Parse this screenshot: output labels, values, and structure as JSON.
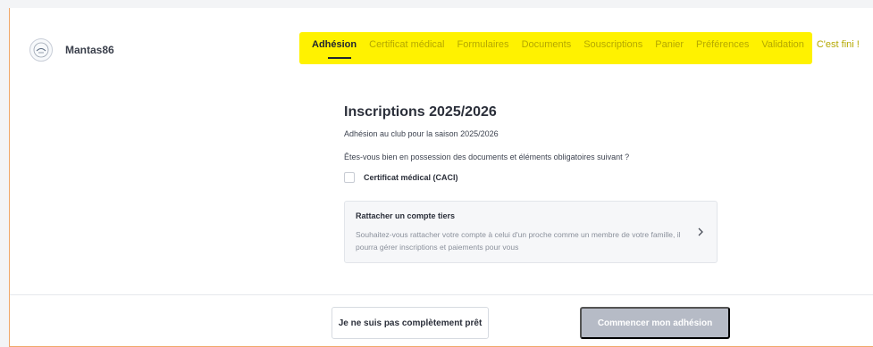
{
  "header": {
    "club_name": "Mantas86",
    "logo_icon": "club-logo-icon",
    "highlight_color": "#fff200",
    "nav": [
      {
        "label": "Adhésion",
        "active": true
      },
      {
        "label": "Certificat médical",
        "active": false
      },
      {
        "label": "Formulaires",
        "active": false
      },
      {
        "label": "Documents",
        "active": false
      },
      {
        "label": "Souscriptions",
        "active": false
      },
      {
        "label": "Panier",
        "active": false
      },
      {
        "label": "Préférences",
        "active": false
      },
      {
        "label": "Validation",
        "active": false
      },
      {
        "label": "C'est fini !",
        "active": false
      }
    ]
  },
  "main": {
    "title": "Inscriptions 2025/2026",
    "subtitle": "Adhésion au club pour la saison 2025/2026",
    "question": "Êtes-vous bien en possession des documents et éléments obligatoires suivant ?",
    "checkbox_label": "Certificat médical (CACI)",
    "card": {
      "title": "Rattacher un compte tiers",
      "text": "Souhaitez-vous rattacher votre compte à celui d'un proche comme un membre de votre famille, il pourra gérer inscriptions et paiements pour vous",
      "icon": "chevron-right-icon"
    }
  },
  "footer": {
    "secondary_label": "Je ne suis pas complètement prêt",
    "primary_label": "Commencer mon adhésion",
    "primary_color": "#b6bbc6"
  }
}
